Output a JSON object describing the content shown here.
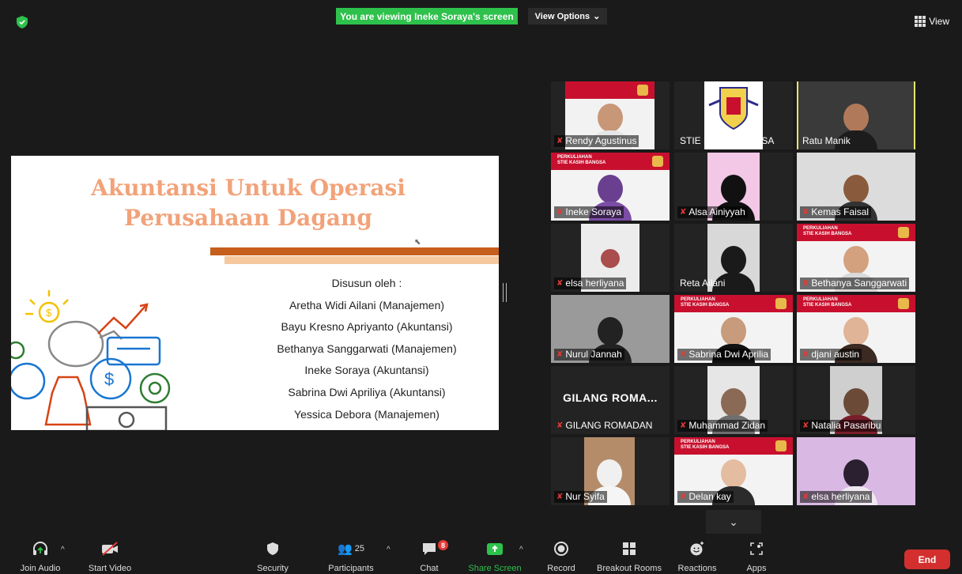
{
  "banner": {
    "text": "You are viewing Ineke Soraya's screen"
  },
  "view_options": {
    "label": "View Options",
    "caret": "⌄"
  },
  "view_button": {
    "label": "View"
  },
  "slide": {
    "title_line1": "Akuntansi Untuk Operasi",
    "title_line2": "Perusahaan Dagang",
    "by": "Disusun oleh :",
    "authors": [
      "Aretha Widi Ailani (Manajemen)",
      "Bayu Kresno Apriyanto (Akuntansi)",
      "Bethanya Sanggarwati (Manajemen)",
      "Ineke Soraya (Akuntansi)",
      "Sabrina Dwi Apriliya (Akuntansi)",
      "Yessica Debora (Manajemen)"
    ]
  },
  "participants": [
    {
      "name": "Rendy Agustinus",
      "muted": true
    },
    {
      "name": "STIE KASIH BANGSA",
      "muted": false
    },
    {
      "name": "Ratu Manik",
      "muted": false
    },
    {
      "name": "Ineke Soraya",
      "muted": true
    },
    {
      "name": "Alsa Ainiyyah",
      "muted": true
    },
    {
      "name": "Kemas Faisal",
      "muted": true
    },
    {
      "name": "elsa herliyana",
      "muted": true
    },
    {
      "name": "Reta Ailani",
      "muted": false
    },
    {
      "name": "Bethanya Sanggarwati",
      "muted": true
    },
    {
      "name": "Nurul Jannah",
      "muted": true
    },
    {
      "name": "Sabrina Dwi Aprilia",
      "muted": true
    },
    {
      "name": "djani austin",
      "muted": true
    },
    {
      "name": "GILANG ROMADAN",
      "muted": true,
      "big_label": "GILANG ROMA..."
    },
    {
      "name": "Muhammad Zidan",
      "muted": true
    },
    {
      "name": "Natalia Pasaribu",
      "muted": true
    },
    {
      "name": "Nur Syifa",
      "muted": true
    },
    {
      "name": "Delan kay",
      "muted": true
    },
    {
      "name": "elsa herliyana",
      "muted": true
    }
  ],
  "slide_banner_text": "PERKULIAHAN\nSTIE KASIH BANGSA",
  "toolbar": {
    "join_audio": "Join Audio",
    "start_video": "Start Video",
    "security": "Security",
    "participants": "Participants",
    "participants_count": "25",
    "chat": "Chat",
    "chat_badge": "8",
    "share_screen": "Share Screen",
    "record": "Record",
    "breakout_rooms": "Breakout Rooms",
    "reactions": "Reactions",
    "apps": "Apps",
    "end": "End"
  },
  "colors": {
    "accent_green": "#2ec14b",
    "end_red": "#d32f2f",
    "slide_title": "#f2a279",
    "active_border": "#e5e76b"
  }
}
